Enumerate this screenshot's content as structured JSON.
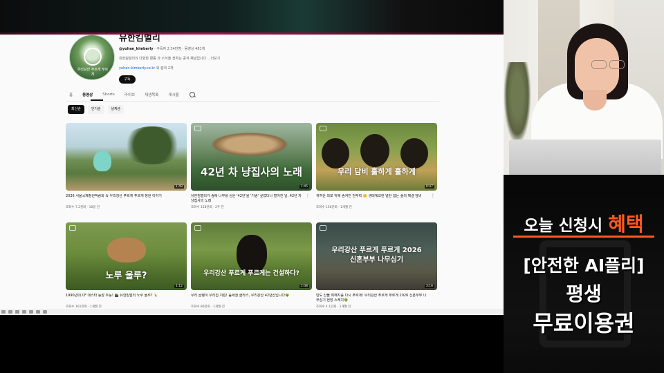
{
  "channel": {
    "name": "유한킴벌리",
    "avatar_text": "우리강산 푸르게 푸르게",
    "handle": "@yuhan_kimberly",
    "meta": "· 구독자 2.34만명 · 동영상 481개",
    "description": "유한킴벌리의 다양한 활동 과 소식을 전하는 공식 채널입니다 ...더보기",
    "link": "yuhan-kimberly.co.kr",
    "link_extra": "외 링크 2개",
    "subscribe_label": "구독"
  },
  "tabs": [
    "홈",
    "동영상",
    "Shorts",
    "라이브",
    "재생목록",
    "게시물"
  ],
  "chips": [
    "최신순",
    "인기순",
    "날짜순"
  ],
  "videos": [
    {
      "title": "2026 서울국제정원박람회 속 우리강산 푸르게 푸르게 정원 이야기",
      "meta": "조회수 7.2천회 · 10일 전",
      "duration": "1:49",
      "overlay": ""
    },
    {
      "title": "유한킴벌리가 숲에 나무를 심은 '42년'을 '기념' 싶었더니 벌어진 일, 42년 차 냥집사의 노래",
      "meta": "조회수 158만회 · 2주 전",
      "duration": "1:45",
      "overlay": "42년 차 냥집사의 노래"
    },
    {
      "title": "귀여운 외모 뒤에 숨겨진 전투력 🙂 생태계교란 멀런 잡는 숲의 해결 담비",
      "meta": "조회수 156만회 · 1개월 전",
      "duration": "0:47",
      "overlay": "우리 담비 훌하게 훌하게"
    },
    {
      "title": "1990년대 CF 대스타 등장 두둥! 🎬 유한킴벌리 노루 울루? 🦌",
      "meta": "조회수 161만회 · 1개월 전",
      "duration": "1:12",
      "overlay": "노루 울루?"
    },
    {
      "title": "우리 곰탱이 우리집 지킴! 숲세권 클라스, 우리강산 42년산입니다🌳",
      "meta": "조회수 86만회 · 1개월 전",
      "duration": "1:08",
      "overlay": "우리강산 푸르게 푸르게는 건설하다?"
    },
    {
      "title": "만도 산불 피해지를 다시 푸르게! 우리강산 푸르게 푸르게 2026 신혼부부 나무심기 현장 스케치🌳",
      "meta": "조회수 4.1만회 · 1개월 전",
      "duration": "3:16",
      "overlay": "우리강산 푸르게 푸르게 2026 신혼부부 나무심기"
    }
  ],
  "promo": {
    "line1_a": "오늘 신청시 ",
    "line1_b": "혜택",
    "line2": "[안전한 AI플리]",
    "line3": "평생",
    "line4": "무료이용권"
  },
  "colors": {
    "accent": "#ff5a1f",
    "link": "#065fd4"
  }
}
